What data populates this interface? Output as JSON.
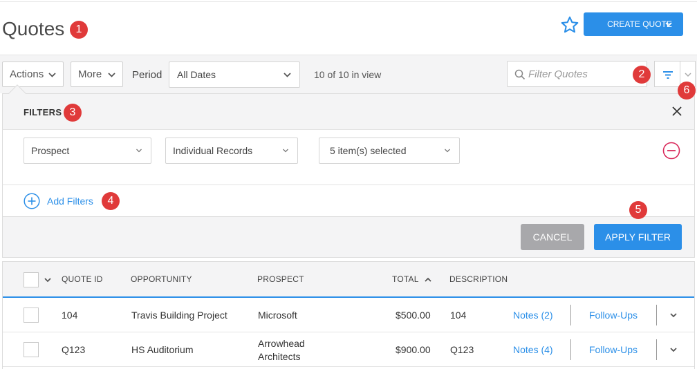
{
  "header": {
    "title": "Quotes",
    "create_label": "CREATE QUOTE"
  },
  "toolbar": {
    "actions_label": "Actions",
    "more_label": "More",
    "period_label": "Period",
    "period_value": "All Dates",
    "in_view": "10 of 10 in view",
    "search_placeholder": "Filter Quotes"
  },
  "filters": {
    "title": "FILTERS",
    "field": "Prospect",
    "mode": "Individual Records",
    "selection": "5 item(s) selected",
    "add_label": "Add Filters",
    "cancel_label": "CANCEL",
    "apply_label": "APPLY FILTER"
  },
  "table": {
    "columns": [
      "QUOTE ID",
      "OPPORTUNITY",
      "PROSPECT",
      "TOTAL",
      "DESCRIPTION"
    ],
    "rows": [
      {
        "id": "104",
        "opportunity": "Travis Building Project",
        "prospect": "Microsoft",
        "total": "$500.00",
        "description": "104",
        "notes": "Notes (2)",
        "followups": "Follow-Ups"
      },
      {
        "id": "Q123",
        "opportunity": "HS Auditorium",
        "prospect": "Arrowhead Architects",
        "total": "$900.00",
        "description": "Q123",
        "notes": "Notes (4)",
        "followups": "Follow-Ups"
      }
    ]
  },
  "annotations": [
    "1",
    "2",
    "3",
    "4",
    "5",
    "6"
  ],
  "colors": {
    "accent": "#2b8fe8",
    "badge": "#e03a3a",
    "remove": "#d9285a",
    "cancel": "#a8a8ab"
  }
}
